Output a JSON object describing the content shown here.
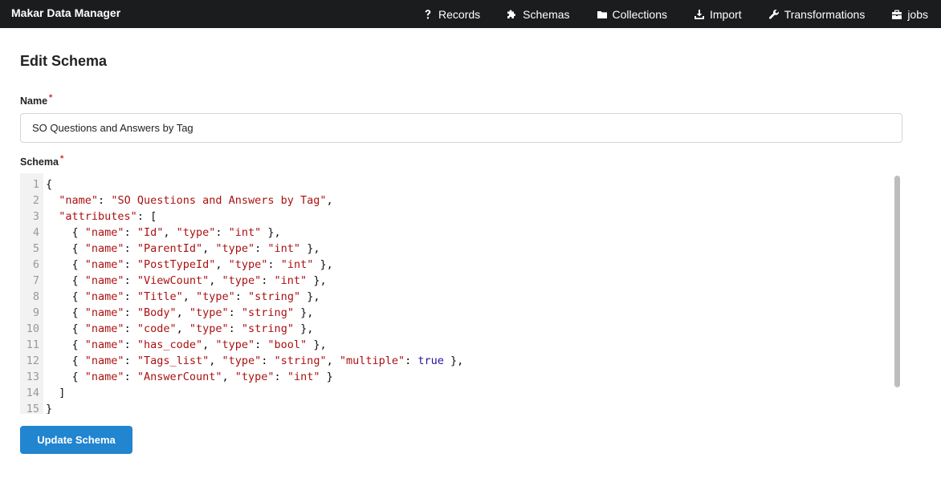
{
  "app": {
    "brand": "Makar Data Manager"
  },
  "nav": {
    "items": [
      {
        "label": "Records",
        "icon": "question-icon"
      },
      {
        "label": "Schemas",
        "icon": "puzzle-icon"
      },
      {
        "label": "Collections",
        "icon": "folder-icon"
      },
      {
        "label": "Import",
        "icon": "download-icon"
      },
      {
        "label": "Transformations",
        "icon": "wrench-icon"
      },
      {
        "label": "jobs",
        "icon": "suitcase-icon"
      }
    ]
  },
  "page": {
    "title": "Edit Schema"
  },
  "form": {
    "name_label": "Name",
    "name_required": "*",
    "name_value": "SO Questions and Answers by Tag",
    "schema_label": "Schema",
    "schema_required": "*",
    "submit_label": "Update Schema"
  },
  "editor": {
    "lines": [
      {
        "n": "1",
        "tokens": [
          [
            "p",
            "{"
          ]
        ]
      },
      {
        "n": "2",
        "tokens": [
          [
            "p",
            "  "
          ],
          [
            "k",
            "\"name\""
          ],
          [
            "p",
            ": "
          ],
          [
            "s",
            "\"SO Questions and Answers by Tag\""
          ],
          [
            "p",
            ","
          ]
        ]
      },
      {
        "n": "3",
        "tokens": [
          [
            "p",
            "  "
          ],
          [
            "k",
            "\"attributes\""
          ],
          [
            "p",
            ": ["
          ]
        ]
      },
      {
        "n": "4",
        "tokens": [
          [
            "p",
            "    { "
          ],
          [
            "k",
            "\"name\""
          ],
          [
            "p",
            ": "
          ],
          [
            "s",
            "\"Id\""
          ],
          [
            "p",
            ", "
          ],
          [
            "k",
            "\"type\""
          ],
          [
            "p",
            ": "
          ],
          [
            "s",
            "\"int\""
          ],
          [
            "p",
            " },"
          ]
        ]
      },
      {
        "n": "5",
        "tokens": [
          [
            "p",
            "    { "
          ],
          [
            "k",
            "\"name\""
          ],
          [
            "p",
            ": "
          ],
          [
            "s",
            "\"ParentId\""
          ],
          [
            "p",
            ", "
          ],
          [
            "k",
            "\"type\""
          ],
          [
            "p",
            ": "
          ],
          [
            "s",
            "\"int\""
          ],
          [
            "p",
            " },"
          ]
        ]
      },
      {
        "n": "6",
        "tokens": [
          [
            "p",
            "    { "
          ],
          [
            "k",
            "\"name\""
          ],
          [
            "p",
            ": "
          ],
          [
            "s",
            "\"PostTypeId\""
          ],
          [
            "p",
            ", "
          ],
          [
            "k",
            "\"type\""
          ],
          [
            "p",
            ": "
          ],
          [
            "s",
            "\"int\""
          ],
          [
            "p",
            " },"
          ]
        ]
      },
      {
        "n": "7",
        "tokens": [
          [
            "p",
            "    { "
          ],
          [
            "k",
            "\"name\""
          ],
          [
            "p",
            ": "
          ],
          [
            "s",
            "\"ViewCount\""
          ],
          [
            "p",
            ", "
          ],
          [
            "k",
            "\"type\""
          ],
          [
            "p",
            ": "
          ],
          [
            "s",
            "\"int\""
          ],
          [
            "p",
            " },"
          ]
        ]
      },
      {
        "n": "8",
        "tokens": [
          [
            "p",
            "    { "
          ],
          [
            "k",
            "\"name\""
          ],
          [
            "p",
            ": "
          ],
          [
            "s",
            "\"Title\""
          ],
          [
            "p",
            ", "
          ],
          [
            "k",
            "\"type\""
          ],
          [
            "p",
            ": "
          ],
          [
            "s",
            "\"string\""
          ],
          [
            "p",
            " },"
          ]
        ]
      },
      {
        "n": "9",
        "tokens": [
          [
            "p",
            "    { "
          ],
          [
            "k",
            "\"name\""
          ],
          [
            "p",
            ": "
          ],
          [
            "s",
            "\"Body\""
          ],
          [
            "p",
            ", "
          ],
          [
            "k",
            "\"type\""
          ],
          [
            "p",
            ": "
          ],
          [
            "s",
            "\"string\""
          ],
          [
            "p",
            " },"
          ]
        ]
      },
      {
        "n": "10",
        "tokens": [
          [
            "p",
            "    { "
          ],
          [
            "k",
            "\"name\""
          ],
          [
            "p",
            ": "
          ],
          [
            "s",
            "\"code\""
          ],
          [
            "p",
            ", "
          ],
          [
            "k",
            "\"type\""
          ],
          [
            "p",
            ": "
          ],
          [
            "s",
            "\"string\""
          ],
          [
            "p",
            " },"
          ]
        ]
      },
      {
        "n": "11",
        "tokens": [
          [
            "p",
            "    { "
          ],
          [
            "k",
            "\"name\""
          ],
          [
            "p",
            ": "
          ],
          [
            "s",
            "\"has_code\""
          ],
          [
            "p",
            ", "
          ],
          [
            "k",
            "\"type\""
          ],
          [
            "p",
            ": "
          ],
          [
            "s",
            "\"bool\""
          ],
          [
            "p",
            " },"
          ]
        ]
      },
      {
        "n": "12",
        "tokens": [
          [
            "p",
            "    { "
          ],
          [
            "k",
            "\"name\""
          ],
          [
            "p",
            ": "
          ],
          [
            "s",
            "\"Tags_list\""
          ],
          [
            "p",
            ", "
          ],
          [
            "k",
            "\"type\""
          ],
          [
            "p",
            ": "
          ],
          [
            "s",
            "\"string\""
          ],
          [
            "p",
            ", "
          ],
          [
            "k",
            "\"multiple\""
          ],
          [
            "p",
            ": "
          ],
          [
            "a",
            "true"
          ],
          [
            "p",
            " },"
          ]
        ]
      },
      {
        "n": "13",
        "tokens": [
          [
            "p",
            "    { "
          ],
          [
            "k",
            "\"name\""
          ],
          [
            "p",
            ": "
          ],
          [
            "s",
            "\"AnswerCount\""
          ],
          [
            "p",
            ", "
          ],
          [
            "k",
            "\"type\""
          ],
          [
            "p",
            ": "
          ],
          [
            "s",
            "\"int\""
          ],
          [
            "p",
            " }"
          ]
        ]
      },
      {
        "n": "14",
        "tokens": [
          [
            "p",
            "  ]"
          ]
        ]
      },
      {
        "n": "15",
        "tokens": [
          [
            "p",
            "}"
          ]
        ]
      }
    ]
  },
  "colors": {
    "navbar_bg": "#1b1c1d",
    "primary_button": "#2185d0",
    "required_marker": "#db2828",
    "json_key": "#aa1111",
    "json_string": "#aa1111",
    "json_atom": "#221199"
  }
}
